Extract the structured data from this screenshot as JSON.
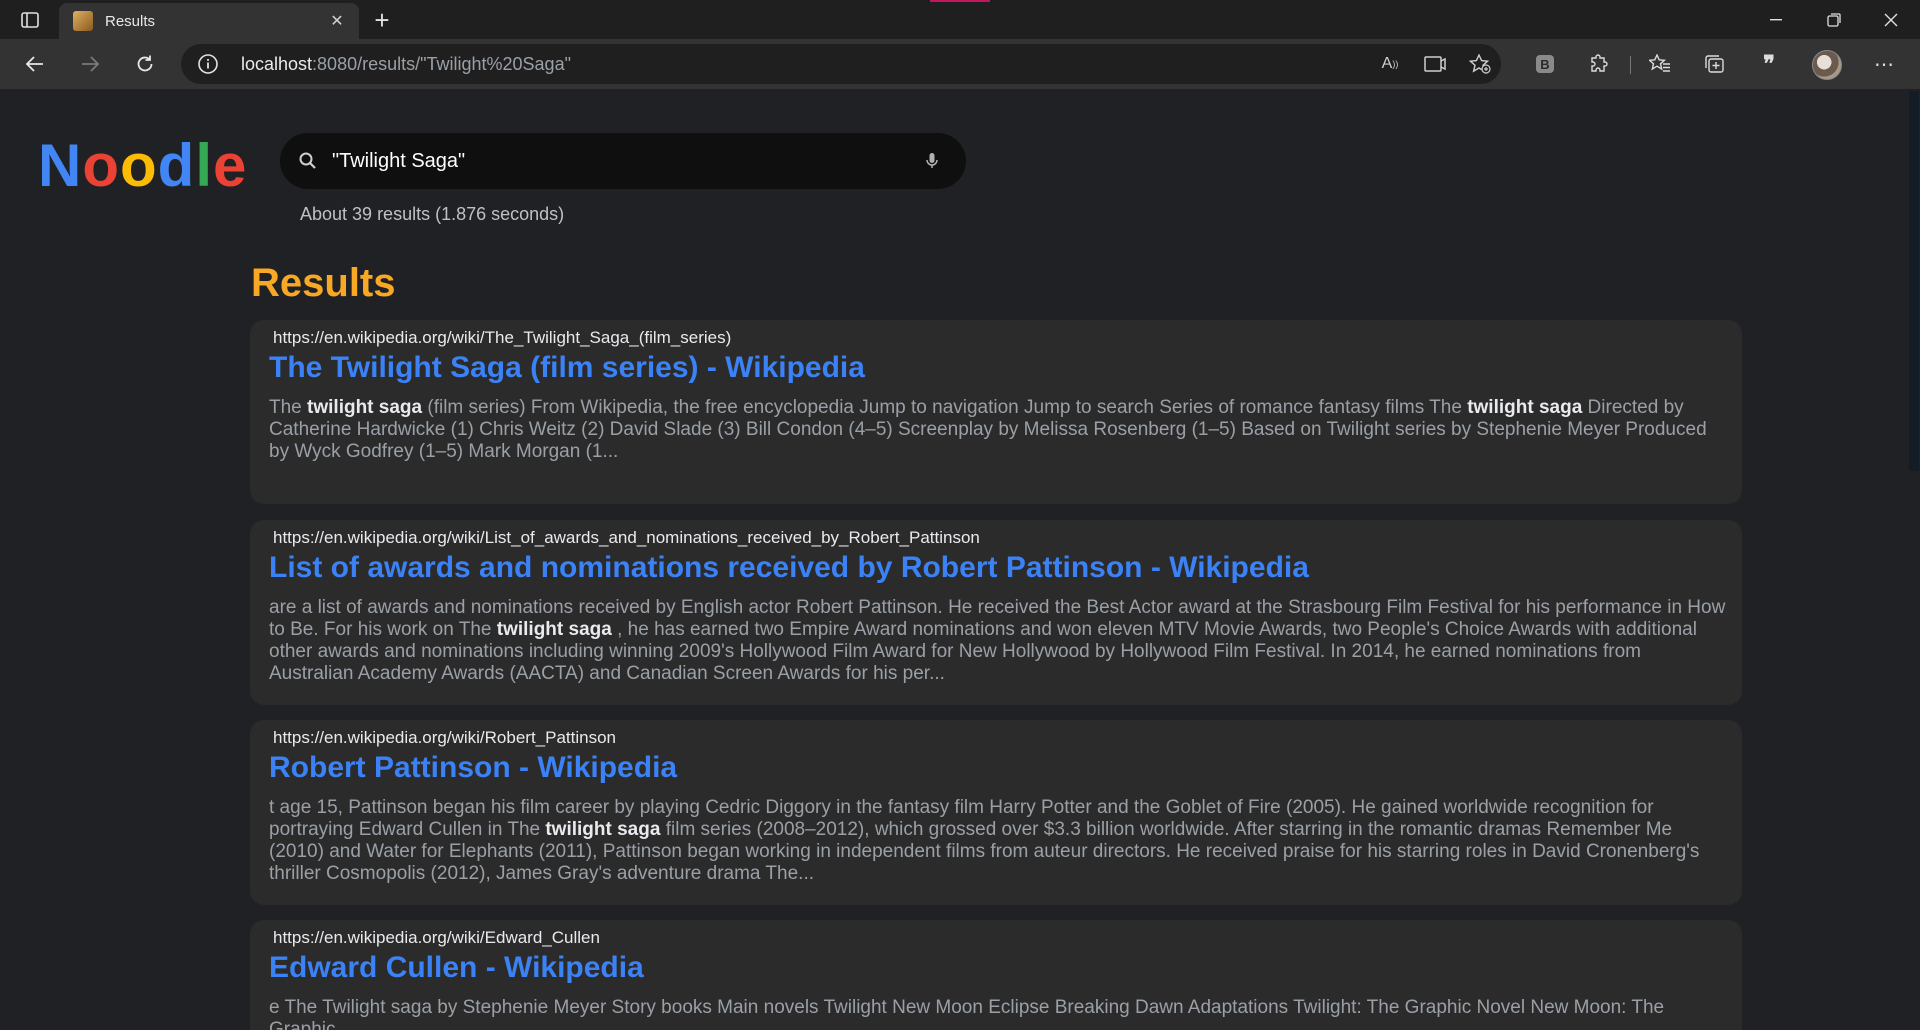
{
  "browser": {
    "tab_title": "Results",
    "url_host": "localhost",
    "url_rest": ":8080/results/\"Twilight%20Saga\""
  },
  "logo": {
    "letters": [
      {
        "char": "N",
        "color": "#4285F4"
      },
      {
        "char": "o",
        "color": "#EA4335"
      },
      {
        "char": "o",
        "color": "#FBBC05"
      },
      {
        "char": "d",
        "color": "#4285F4"
      },
      {
        "char": "l",
        "color": "#34A853"
      },
      {
        "char": "e",
        "color": "#EA4335"
      }
    ]
  },
  "search": {
    "value": "\"Twilight Saga\""
  },
  "stats": "About 39 results (1.876 seconds)",
  "results_heading": "Results",
  "results": [
    {
      "url": "https://en.wikipedia.org/wiki/The_Twilight_Saga_(film_series)",
      "title": "The Twilight Saga (film series) - Wikipedia",
      "snippet": [
        {
          "t": "The "
        },
        {
          "t": "twilight saga",
          "b": true
        },
        {
          "t": " (film series) From Wikipedia, the free encyclopedia Jump to navigation Jump to search Series of romance fantasy films The "
        },
        {
          "t": "twilight saga",
          "b": true
        },
        {
          "t": " Directed by Catherine Hardwicke (1) Chris Weitz (2) David Slade (3) Bill Condon (4–5) Screenplay by Melissa Rosenberg (1–5) Based on Twilight series by Stephenie Meyer Produced by Wyck Godfrey (1–5) Mark Morgan (1..."
        }
      ]
    },
    {
      "url": "https://en.wikipedia.org/wiki/List_of_awards_and_nominations_received_by_Robert_Pattinson",
      "title": "List of awards and nominations received by Robert Pattinson - Wikipedia",
      "snippet": [
        {
          "t": "are a list of awards and nominations received by English actor Robert Pattinson. He received the Best Actor award at the Strasbourg Film Festival for his performance in How to Be. For his work on The "
        },
        {
          "t": "twilight saga",
          "b": true
        },
        {
          "t": " , he has earned two Empire Award nominations and won eleven MTV Movie Awards, two People's Choice Awards with additional other awards and nominations including winning 2009's Hollywood Film Award for New Hollywood by Hollywood Film Festival. In 2014, he earned nominations from Australian Academy Awards (AACTA) and Canadian Screen Awards for his per..."
        }
      ]
    },
    {
      "url": "https://en.wikipedia.org/wiki/Robert_Pattinson",
      "title": "Robert Pattinson - Wikipedia",
      "snippet": [
        {
          "t": "t age 15, Pattinson began his film career by playing Cedric Diggory in the fantasy film Harry Potter and the Goblet of Fire (2005). He gained worldwide recognition for portraying Edward Cullen in The "
        },
        {
          "t": "twilight saga",
          "b": true
        },
        {
          "t": " film series (2008–2012), which grossed over $3.3 billion worldwide. After starring in the romantic dramas Remember Me (2010) and Water for Elephants (2011), Pattinson began working in independent films from auteur directors. He received praise for his starring roles in David Cronenberg's thriller Cosmopolis (2012), James Gray's adventure drama The..."
        }
      ]
    },
    {
      "url": "https://en.wikipedia.org/wiki/Edward_Cullen",
      "title": "Edward Cullen - Wikipedia",
      "snippet": [
        {
          "t": "e The Twilight saga by Stephenie Meyer Story books Main novels Twilight New Moon Eclipse Breaking Dawn Adaptations Twilight: The Graphic Novel New Moon: The Graphic"
        }
      ]
    }
  ]
}
